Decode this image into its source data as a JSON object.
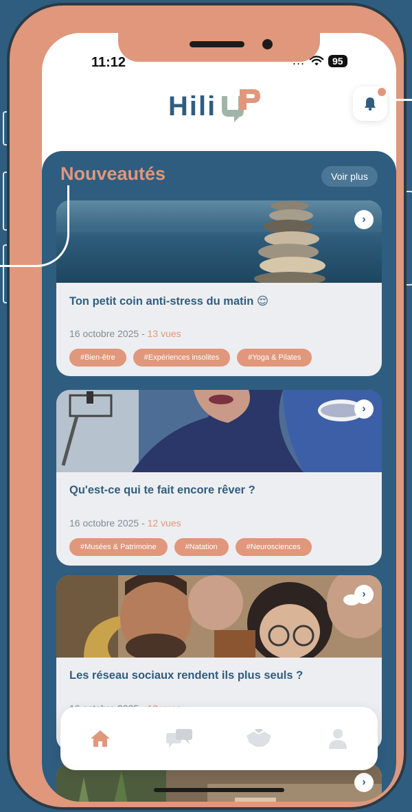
{
  "status_bar": {
    "time": "11:12",
    "signal": "...",
    "battery": "95"
  },
  "header": {
    "logo_text": "Hili",
    "logo_mark_text": "UP"
  },
  "news": {
    "title": "Nouveautés",
    "see_more_label": "Voir plus",
    "cards": [
      {
        "title": "Ton petit coin anti-stress du matin 😌",
        "date": "16 octobre 2025 - ",
        "views": "13 vues",
        "tags": [
          "#Bien-être",
          "#Expériences insolites",
          "#Yoga & Pilates"
        ]
      },
      {
        "title": "Qu'est-ce qui te fait encore rêver ?",
        "date": "16 octobre 2025 - ",
        "views": "12 vues",
        "tags": [
          "#Musées & Patrimoine",
          "#Natation",
          "#Neurosciences"
        ]
      },
      {
        "title": "Les réseau sociaux rendent ils plus seuls ?",
        "date": "16 octobre 2025 - ",
        "views": "12 vues",
        "tags": []
      }
    ],
    "arrow_glyph": "›"
  },
  "nav": {
    "items": [
      {
        "icon": "home-icon",
        "active": true
      },
      {
        "icon": "chat-icon",
        "active": false
      },
      {
        "icon": "handshake-icon",
        "active": false
      },
      {
        "icon": "profile-icon",
        "active": false
      }
    ]
  },
  "colors": {
    "brand_blue": "#2f5d7f",
    "accent_salmon": "#e0977b",
    "logo_green": "#9fb5a8",
    "card_bg": "#edeef1"
  }
}
